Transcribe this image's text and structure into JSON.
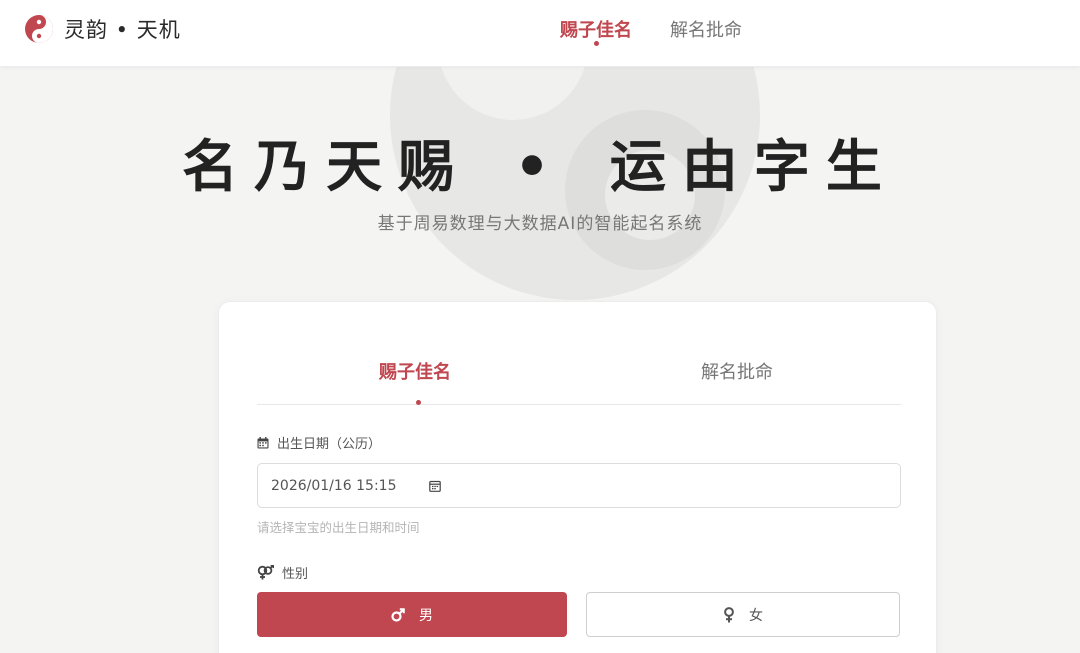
{
  "header": {
    "logo_text": "灵韵 • 天机",
    "nav": [
      {
        "label": "赐子佳名",
        "active": true
      },
      {
        "label": "解名批命",
        "active": false
      }
    ]
  },
  "hero": {
    "title_left": "名乃天赐",
    "title_dot": "•",
    "title_right": "运由字生",
    "subtitle": "基于周易数理与大数据AI的智能起名系统"
  },
  "form": {
    "tabs": [
      {
        "label": "赐子佳名",
        "active": true
      },
      {
        "label": "解名批命",
        "active": false
      }
    ],
    "birth_label": "出生日期（公历）",
    "birth_value": "2026/01/16 15:15",
    "birth_hint": "请选择宝宝的出生日期和时间",
    "gender_label": "性别",
    "gender_options": [
      {
        "label": "男",
        "selected": true,
        "icon": "male-icon"
      },
      {
        "label": "女",
        "selected": false,
        "icon": "female-icon"
      }
    ]
  },
  "colors": {
    "accent": "#c0474f",
    "background": "#f4f4f3"
  }
}
